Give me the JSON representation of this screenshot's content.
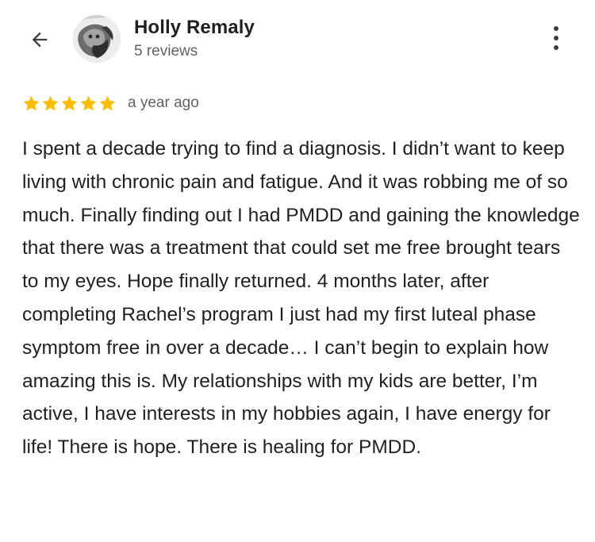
{
  "header": {
    "back_icon": "arrow-back-icon",
    "author_name": "Holly Remaly",
    "review_count": "5 reviews",
    "more_icon": "more-vertical-icon"
  },
  "review": {
    "rating": 5,
    "rating_max": 5,
    "star_color": "#fbbc04",
    "date": "a year ago",
    "text": "I spent a decade trying to find a diagnosis. I didn’t want to keep living with chronic pain and fatigue. And it was robbing me of so much. Finally finding out I had PMDD and gaining the knowledge that there was a treatment that could set me free brought tears to my eyes. Hope finally returned. 4 months later, after completing Rachel’s program I just had my first luteal phase symptom free in over a decade… I can’t begin to explain how amazing this is. My relationships with my kids are better, I’m active, I have interests in my hobbies again, I have energy for life! There is hope. There is healing for PMDD."
  }
}
